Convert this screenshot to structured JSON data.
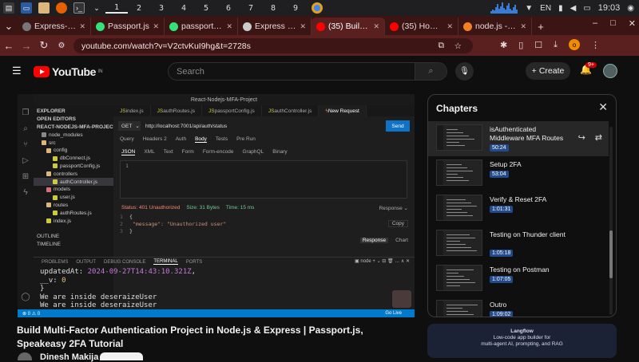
{
  "taskbar": {
    "workspaces": [
      "1",
      "2",
      "3",
      "4",
      "5",
      "6",
      "7",
      "8",
      "9"
    ],
    "active_workspace": 1,
    "lang": "EN",
    "clock": "19:03"
  },
  "tabs": [
    {
      "label": "Express-sess",
      "color": "#777777",
      "active": false
    },
    {
      "label": "Passport.js",
      "color": "#34e27a",
      "active": false
    },
    {
      "label": "passport-loca",
      "color": "#34e27a",
      "active": false
    },
    {
      "label": "Express sessi",
      "color": "#cccccc",
      "active": false
    },
    {
      "label": "(35) Build M",
      "color": "#ff0000",
      "active": true
    },
    {
      "label": "(35) How To I",
      "color": "#ff0000",
      "active": false
    },
    {
      "label": "node.js - Pass",
      "color": "#f48024",
      "active": false
    }
  ],
  "address": {
    "url": "youtube.com/watch?v=V2ctvKuI9hg&t=2728s"
  },
  "youtube": {
    "logo": "YouTube",
    "region": "IN",
    "search_placeholder": "Search",
    "create_label": "Create",
    "notif_count": "9+",
    "video_title": "Build Multi-Factor Authentication Project in Node.js & Express | Passport.js, Speakeasy 2FA Tutorial",
    "channel": "Dinesh Makija"
  },
  "vscode": {
    "top_title": "React-Nodejs-MFA-Project",
    "explorer_rows": [
      {
        "label": "EXPLORER",
        "indent": 4,
        "color": "",
        "sel": false
      },
      {
        "label": "OPEN EDITORS",
        "indent": 4,
        "color": "",
        "sel": false
      },
      {
        "label": "REACT-NODEJS-MFA-PROJECT",
        "indent": 4,
        "color": "",
        "sel": false
      },
      {
        "label": "node_modules",
        "indent": 10,
        "color": "#8a8a8a",
        "sel": false
      },
      {
        "label": "src",
        "indent": 10,
        "color": "#dcb67a",
        "sel": false
      },
      {
        "label": "config",
        "indent": 16,
        "color": "#dcb67a",
        "sel": false
      },
      {
        "label": "dbConnect.js",
        "indent": 24,
        "color": "#cbcb41",
        "sel": false
      },
      {
        "label": "passportConfig.js",
        "indent": 24,
        "color": "#cbcb41",
        "sel": false
      },
      {
        "label": "controllers",
        "indent": 16,
        "color": "#dcb67a",
        "sel": false
      },
      {
        "label": "authController.js",
        "indent": 24,
        "color": "#cbcb41",
        "sel": true
      },
      {
        "label": "models",
        "indent": 16,
        "color": "#e06c75",
        "sel": false
      },
      {
        "label": "user.js",
        "indent": 24,
        "color": "#cbcb41",
        "sel": false
      },
      {
        "label": "routes",
        "indent": 16,
        "color": "#dcb67a",
        "sel": false
      },
      {
        "label": "authRoutes.js",
        "indent": 24,
        "color": "#cbcb41",
        "sel": false
      },
      {
        "label": "index.js",
        "indent": 16,
        "color": "#cbcb41",
        "sel": false
      },
      {
        "label": "",
        "indent": 4,
        "color": "",
        "sel": false
      },
      {
        "label": "OUTLINE",
        "indent": 4,
        "color": "",
        "sel": false
      },
      {
        "label": "TIMELINE",
        "indent": 4,
        "color": "",
        "sel": false
      }
    ],
    "editor_tabs": [
      {
        "label": "index.js",
        "active": false
      },
      {
        "label": "authRoutes.js",
        "active": false
      },
      {
        "label": "passportConfig.js",
        "active": false
      },
      {
        "label": "authController.js",
        "active": false
      },
      {
        "label": "New Request",
        "active": true
      }
    ],
    "method": "GET",
    "request_url": "http://localhost:7001/api/auth/status",
    "send_label": "Send",
    "subtabs": [
      {
        "label": "Query",
        "on": false
      },
      {
        "label": "Headers 2",
        "on": false
      },
      {
        "label": "Auth",
        "on": false
      },
      {
        "label": "Body",
        "on": true
      },
      {
        "label": "Tests",
        "on": false
      },
      {
        "label": "Pre Run",
        "on": false
      }
    ],
    "body_types": [
      {
        "label": "JSON",
        "on": true
      },
      {
        "label": "XML",
        "on": false
      },
      {
        "label": "Text",
        "on": false
      },
      {
        "label": "Form",
        "on": false
      },
      {
        "label": "Form-encode",
        "on": false
      },
      {
        "label": "GraphQL",
        "on": false
      },
      {
        "label": "Binary",
        "on": false
      }
    ],
    "editor_line": "1",
    "status_text": "Status: 401 Unauthorized",
    "size_text": "Size: 31 Bytes",
    "time_text": "Time: 15 ms",
    "response_label": "Response",
    "response_lines": [
      {
        "n": "1",
        "text": "{"
      },
      {
        "n": "2",
        "text": "  \"message\": \"Unauthorized user\""
      },
      {
        "n": "3",
        "text": "}"
      }
    ],
    "copy_label": "Copy",
    "resp_tabs": [
      {
        "label": "Response",
        "on": true
      },
      {
        "label": "Chart",
        "on": false
      }
    ],
    "panel_tabs": [
      {
        "label": "PROBLEMS",
        "on": false
      },
      {
        "label": "OUTPUT",
        "on": false
      },
      {
        "label": "DEBUG CONSOLE",
        "on": false
      },
      {
        "label": "TERMINAL",
        "on": true
      },
      {
        "label": "PORTS",
        "on": false
      }
    ],
    "panel_right": "node",
    "terminal": {
      "l1_key": "updatedAt: ",
      "l1_val": "2024-09-27T14:43:10.321Z",
      "l1_end": ",",
      "l2_key": "__v: ",
      "l2_val": "0",
      "l3": "}",
      "l4": "We are inside deseraizeUser",
      "l5": "We are inside deseraizeUser"
    },
    "status_bar": [
      "⊗ 0  ⚠ 0",
      "Go Live"
    ]
  },
  "chapters": {
    "title": "Chapters",
    "items": [
      {
        "name": "isAuthenticated Middleware MFA Routes",
        "time": "50:24",
        "active": true
      },
      {
        "name": "Setup 2FA",
        "time": "53:04",
        "active": false
      },
      {
        "name": "Verify & Reset 2FA",
        "time": "1:01:31",
        "active": false
      },
      {
        "name": "Testing on Thunder client",
        "time": "1:05:18",
        "active": false
      },
      {
        "name": "Testing on Postman",
        "time": "1:07:05",
        "active": false
      },
      {
        "name": "Outro",
        "time": "1:09:02",
        "active": false
      }
    ]
  },
  "ad": {
    "brand": "Langflow",
    "line1": "Low-code app builder for",
    "line2": "multi-agent AI, prompting, and RAG"
  }
}
